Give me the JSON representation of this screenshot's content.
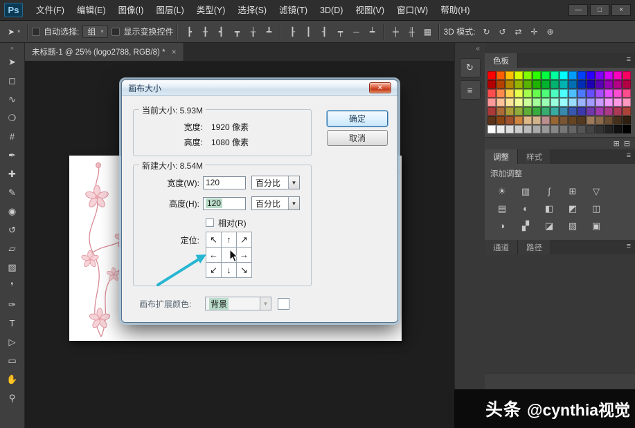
{
  "colors": {
    "selection_highlight": "#b9dcc8",
    "annotation_arrow": "#27b6d2",
    "dialog_title_text": "#1f3a57"
  },
  "app": {
    "logo_text": "Ps",
    "menus": [
      "文件(F)",
      "编辑(E)",
      "图像(I)",
      "图层(L)",
      "类型(Y)",
      "选择(S)",
      "滤镜(T)",
      "3D(D)",
      "视图(V)",
      "窗口(W)",
      "帮助(H)"
    ],
    "window_buttons": [
      {
        "name": "minimize-button",
        "glyph": "—"
      },
      {
        "name": "maximize-button",
        "glyph": "□"
      },
      {
        "name": "close-button",
        "glyph": "×"
      }
    ]
  },
  "chrome": {
    "toolstrip_grip": "»",
    "dock_collapse": "«",
    "panel_menu_glyph": "≡",
    "dropdown_glyph": "▾"
  },
  "options_bar": {
    "tool_preset_glyph": "➤",
    "auto_select_label": "自动选择:",
    "auto_select_value": "组",
    "show_transform_label": "显示变换控件",
    "mode_3d_label": "3D 模式:",
    "align_icons": [
      {
        "name": "align-left-icon",
        "glyph": "┣"
      },
      {
        "name": "align-center-h-icon",
        "glyph": "╂"
      },
      {
        "name": "align-right-icon",
        "glyph": "┫"
      },
      {
        "name": "align-top-icon",
        "glyph": "┳"
      },
      {
        "name": "align-center-v-icon",
        "glyph": "╁"
      },
      {
        "name": "align-bottom-icon",
        "glyph": "┻"
      }
    ],
    "distribute_icons": [
      {
        "name": "distribute-top-icon",
        "glyph": "┠"
      },
      {
        "name": "distribute-center-v-icon",
        "glyph": "┃"
      },
      {
        "name": "distribute-bottom-icon",
        "glyph": "┨"
      },
      {
        "name": "distribute-left-icon",
        "glyph": "┯"
      },
      {
        "name": "distribute-center-h-icon",
        "glyph": "─"
      },
      {
        "name": "distribute-right-icon",
        "glyph": "┷"
      }
    ],
    "extra_icons": [
      {
        "name": "distribute-spacing-h-icon",
        "glyph": "╪"
      },
      {
        "name": "distribute-spacing-v-icon",
        "glyph": "╫"
      },
      {
        "name": "auto-align-layers-icon",
        "glyph": "▦"
      }
    ],
    "threed_icons": [
      {
        "name": "3d-rotate-icon",
        "glyph": "↻"
      },
      {
        "name": "3d-roll-icon",
        "glyph": "↺"
      },
      {
        "name": "3d-pan-icon",
        "glyph": "⇄"
      },
      {
        "name": "3d-slide-icon",
        "glyph": "✛"
      },
      {
        "name": "3d-scale-icon",
        "glyph": "⊕"
      }
    ]
  },
  "toolbar": {
    "tools": [
      {
        "name": "move-tool",
        "glyph": "➤"
      },
      {
        "name": "marquee-tool",
        "glyph": "◻"
      },
      {
        "name": "lasso-tool",
        "glyph": "∿"
      },
      {
        "name": "quick-selection-tool",
        "glyph": "❍"
      },
      {
        "name": "crop-tool",
        "glyph": "#"
      },
      {
        "name": "eyedropper-tool",
        "glyph": "✒"
      },
      {
        "name": "healing-brush-tool",
        "glyph": "✚"
      },
      {
        "name": "brush-tool",
        "glyph": "✎"
      },
      {
        "name": "clone-stamp-tool",
        "glyph": "◉"
      },
      {
        "name": "history-brush-tool",
        "glyph": "↺"
      },
      {
        "name": "eraser-tool",
        "glyph": "▱"
      },
      {
        "name": "gradient-tool",
        "glyph": "▧"
      },
      {
        "name": "blur-tool",
        "glyph": "❜"
      },
      {
        "name": "pen-tool",
        "glyph": "✑"
      },
      {
        "name": "type-tool",
        "glyph": "T"
      },
      {
        "name": "path-selection-tool",
        "glyph": "▷"
      },
      {
        "name": "rectangle-tool",
        "glyph": "▭"
      },
      {
        "name": "hand-tool",
        "glyph": "✋"
      },
      {
        "name": "zoom-tool",
        "glyph": "⚲"
      }
    ]
  },
  "document_tab": {
    "title": "未标题-1 @ 25% (logo2788, RGB/8) *",
    "close_glyph": "×"
  },
  "dialog": {
    "title": "画布大小",
    "close_glyph": "✕",
    "ok_label": "确定",
    "cancel_label": "取消",
    "current_size": {
      "legend": "当前大小: 5.93M",
      "width_label": "宽度:",
      "width_value": "1920 像素",
      "height_label": "高度:",
      "height_value": "1080 像素"
    },
    "new_size": {
      "legend": "新建大小: 8.54M",
      "width_label": "宽度(W):",
      "width_value": "120",
      "width_unit": "百分比",
      "height_label": "高度(H):",
      "height_value": "120",
      "height_unit": "百分比",
      "relative_label": "相对(R)",
      "anchor_label": "定位:"
    },
    "anchor_cells": [
      "↖",
      "↑",
      "↗",
      "←",
      "",
      "→",
      "↙",
      "↓",
      "↘"
    ],
    "canvas_color_label": "画布扩展颜色:",
    "canvas_color_value": "背景"
  },
  "dock_icons": [
    {
      "name": "history-panel-icon",
      "glyph": "↻"
    },
    {
      "name": "properties-panel-icon",
      "glyph": "≡"
    }
  ],
  "panels": {
    "swatches": {
      "tab": "色板",
      "footer_icons": [
        {
          "name": "new-swatch-icon",
          "glyph": "⊞"
        },
        {
          "name": "delete-swatch-icon",
          "glyph": "⊟"
        }
      ],
      "colors": [
        "#ff0000",
        "#ff5e00",
        "#ffbf00",
        "#d8ff00",
        "#80ff00",
        "#2bff00",
        "#00ff40",
        "#00ff9d",
        "#00ffff",
        "#009dff",
        "#0040ff",
        "#2b00ff",
        "#8000ff",
        "#d400ff",
        "#ff00bf",
        "#ff0062",
        "#b30000",
        "#b34200",
        "#b38600",
        "#97b300",
        "#59b300",
        "#1eb300",
        "#00b32d",
        "#00b36e",
        "#00b3b3",
        "#006eb3",
        "#002db3",
        "#1e00b3",
        "#5900b3",
        "#9500b3",
        "#b30086",
        "#b30045",
        "#ff4d4d",
        "#ff8c4d",
        "#ffd24d",
        "#e6ff4d",
        "#a6ff4d",
        "#66ff4d",
        "#4dff79",
        "#4dffbf",
        "#4dffff",
        "#4dbfff",
        "#4d79ff",
        "#664dff",
        "#a64dff",
        "#e64dff",
        "#ff4dd2",
        "#ff4d8c",
        "#ff9999",
        "#ffc299",
        "#ffe699",
        "#f2ff99",
        "#ccff99",
        "#a3ff99",
        "#99ffb3",
        "#99ffdd",
        "#99ffff",
        "#99ddff",
        "#99b3ff",
        "#a399ff",
        "#cc99ff",
        "#f299ff",
        "#ff99e6",
        "#ff99c2",
        "#ac3939",
        "#ac6b39",
        "#ac9d39",
        "#91ac39",
        "#5fac39",
        "#39ac3e",
        "#39ac70",
        "#39aca2",
        "#3989ac",
        "#3957ac",
        "#3d39ac",
        "#6f39ac",
        "#a139ac",
        "#ac3987",
        "#ac3955",
        "#ac4339",
        "#5c3317",
        "#8b4513",
        "#a0522d",
        "#cd853f",
        "#deb887",
        "#d2b48c",
        "#bc8f8f",
        "#996633",
        "#7a5533",
        "#664422",
        "#53391f",
        "#9c7a5a",
        "#8a6a4a",
        "#6b4e32",
        "#46301c",
        "#2e1f10",
        "#ffffff",
        "#eeeeee",
        "#dddddd",
        "#cccccc",
        "#bbbbbb",
        "#aaaaaa",
        "#999999",
        "#888888",
        "#777777",
        "#666666",
        "#555555",
        "#444444",
        "#333333",
        "#222222",
        "#111111",
        "#000000"
      ]
    },
    "adjustments": {
      "tab": "调整",
      "styles_tab": "样式",
      "add_label": "添加调整",
      "icons": [
        {
          "name": "brightness-contrast-icon",
          "glyph": "☀"
        },
        {
          "name": "levels-icon",
          "glyph": "▥"
        },
        {
          "name": "curves-icon",
          "glyph": "∫"
        },
        {
          "name": "exposure-icon",
          "glyph": "⊞"
        },
        {
          "name": "vibrance-icon",
          "glyph": "▽"
        },
        {
          "name": "hue-saturation-icon",
          "glyph": "▤"
        },
        {
          "name": "color-balance-icon",
          "glyph": "◐"
        },
        {
          "name": "black-white-icon",
          "glyph": "◧"
        },
        {
          "name": "photo-filter-icon",
          "glyph": "◩"
        },
        {
          "name": "channel-mixer-icon",
          "glyph": "◫"
        },
        {
          "name": "invert-icon",
          "glyph": "◑"
        },
        {
          "name": "posterize-icon",
          "glyph": "▞"
        },
        {
          "name": "threshold-icon",
          "glyph": "◪"
        },
        {
          "name": "gradient-map-icon",
          "glyph": "▨"
        },
        {
          "name": "selective-color-icon",
          "glyph": "▣"
        }
      ]
    },
    "channels_tab": "通道",
    "paths_tab": "路径"
  },
  "watermark": {
    "brand": "头条",
    "handle": "@cynthia视觉"
  }
}
